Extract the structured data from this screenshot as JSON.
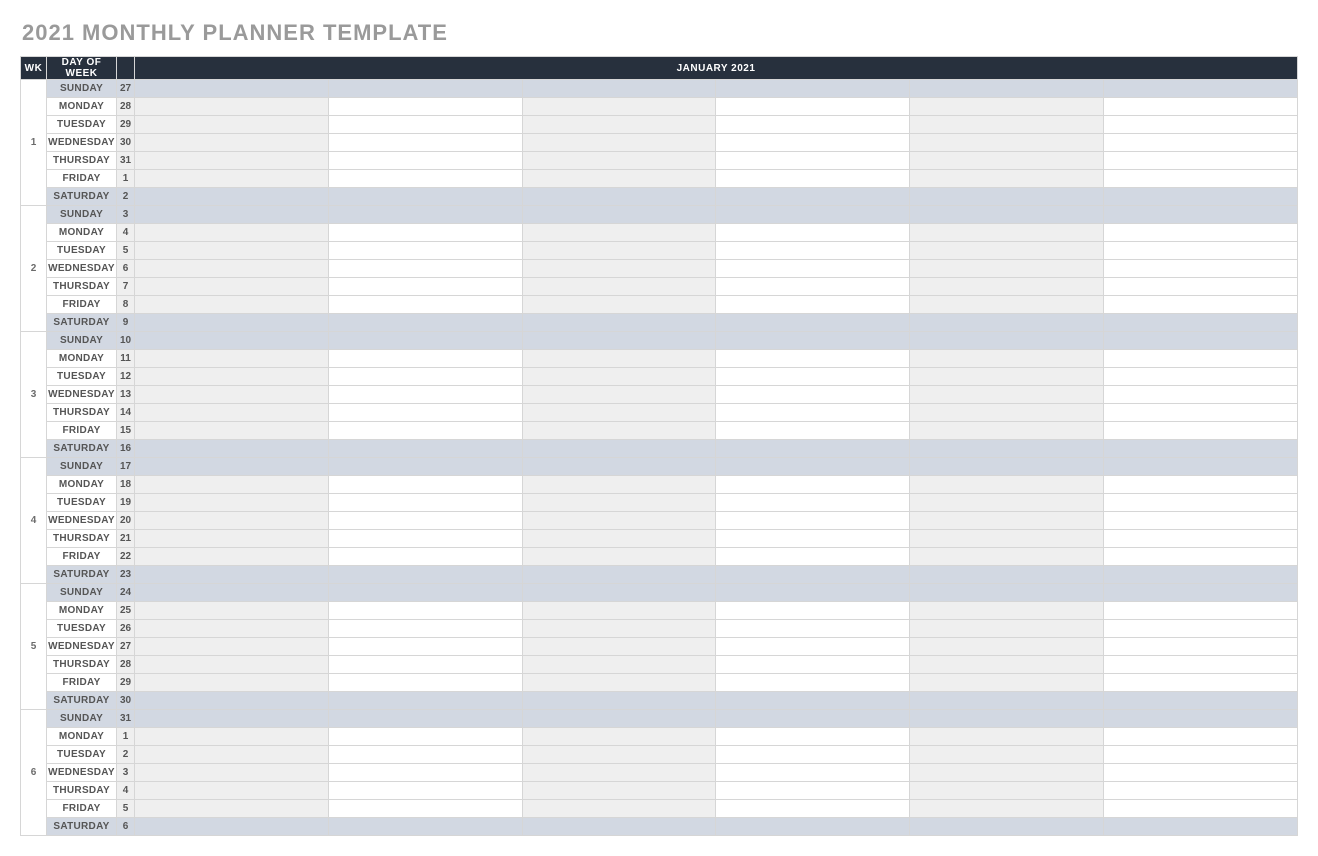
{
  "title": "2021 MONTHLY PLANNER TEMPLATE",
  "headers": {
    "wk": "WK",
    "day_of_week": "DAY OF WEEK",
    "month": "JANUARY 2021"
  },
  "num_slot_columns": 6,
  "weeks": [
    {
      "wk": "1",
      "days": [
        {
          "dow": "SUNDAY",
          "date": "27",
          "weekend": true
        },
        {
          "dow": "MONDAY",
          "date": "28",
          "weekend": false
        },
        {
          "dow": "TUESDAY",
          "date": "29",
          "weekend": false
        },
        {
          "dow": "WEDNESDAY",
          "date": "30",
          "weekend": false
        },
        {
          "dow": "THURSDAY",
          "date": "31",
          "weekend": false
        },
        {
          "dow": "FRIDAY",
          "date": "1",
          "weekend": false
        },
        {
          "dow": "SATURDAY",
          "date": "2",
          "weekend": true
        }
      ]
    },
    {
      "wk": "2",
      "days": [
        {
          "dow": "SUNDAY",
          "date": "3",
          "weekend": true
        },
        {
          "dow": "MONDAY",
          "date": "4",
          "weekend": false
        },
        {
          "dow": "TUESDAY",
          "date": "5",
          "weekend": false
        },
        {
          "dow": "WEDNESDAY",
          "date": "6",
          "weekend": false
        },
        {
          "dow": "THURSDAY",
          "date": "7",
          "weekend": false
        },
        {
          "dow": "FRIDAY",
          "date": "8",
          "weekend": false
        },
        {
          "dow": "SATURDAY",
          "date": "9",
          "weekend": true
        }
      ]
    },
    {
      "wk": "3",
      "days": [
        {
          "dow": "SUNDAY",
          "date": "10",
          "weekend": true
        },
        {
          "dow": "MONDAY",
          "date": "11",
          "weekend": false
        },
        {
          "dow": "TUESDAY",
          "date": "12",
          "weekend": false
        },
        {
          "dow": "WEDNESDAY",
          "date": "13",
          "weekend": false
        },
        {
          "dow": "THURSDAY",
          "date": "14",
          "weekend": false
        },
        {
          "dow": "FRIDAY",
          "date": "15",
          "weekend": false
        },
        {
          "dow": "SATURDAY",
          "date": "16",
          "weekend": true
        }
      ]
    },
    {
      "wk": "4",
      "days": [
        {
          "dow": "SUNDAY",
          "date": "17",
          "weekend": true
        },
        {
          "dow": "MONDAY",
          "date": "18",
          "weekend": false
        },
        {
          "dow": "TUESDAY",
          "date": "19",
          "weekend": false
        },
        {
          "dow": "WEDNESDAY",
          "date": "20",
          "weekend": false
        },
        {
          "dow": "THURSDAY",
          "date": "21",
          "weekend": false
        },
        {
          "dow": "FRIDAY",
          "date": "22",
          "weekend": false
        },
        {
          "dow": "SATURDAY",
          "date": "23",
          "weekend": true
        }
      ]
    },
    {
      "wk": "5",
      "days": [
        {
          "dow": "SUNDAY",
          "date": "24",
          "weekend": true
        },
        {
          "dow": "MONDAY",
          "date": "25",
          "weekend": false
        },
        {
          "dow": "TUESDAY",
          "date": "26",
          "weekend": false
        },
        {
          "dow": "WEDNESDAY",
          "date": "27",
          "weekend": false
        },
        {
          "dow": "THURSDAY",
          "date": "28",
          "weekend": false
        },
        {
          "dow": "FRIDAY",
          "date": "29",
          "weekend": false
        },
        {
          "dow": "SATURDAY",
          "date": "30",
          "weekend": true
        }
      ]
    },
    {
      "wk": "6",
      "days": [
        {
          "dow": "SUNDAY",
          "date": "31",
          "weekend": true
        },
        {
          "dow": "MONDAY",
          "date": "1",
          "weekend": false
        },
        {
          "dow": "TUESDAY",
          "date": "2",
          "weekend": false
        },
        {
          "dow": "WEDNESDAY",
          "date": "3",
          "weekend": false
        },
        {
          "dow": "THURSDAY",
          "date": "4",
          "weekend": false
        },
        {
          "dow": "FRIDAY",
          "date": "5",
          "weekend": false
        },
        {
          "dow": "SATURDAY",
          "date": "6",
          "weekend": true
        }
      ]
    }
  ]
}
